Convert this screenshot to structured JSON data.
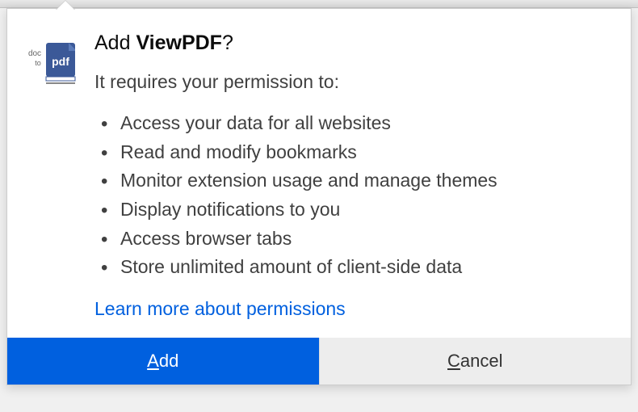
{
  "dialog": {
    "title_prefix": "Add ",
    "title_name": "ViewPDF",
    "title_suffix": "?",
    "subtitle": "It requires your permission to:",
    "permissions": [
      "Access your data for all websites",
      "Read and modify bookmarks",
      "Monitor extension usage and manage themes",
      "Display notifications to you",
      "Access browser tabs",
      "Store unlimited amount of client-side data"
    ],
    "learn_more": "Learn more about permissions",
    "buttons": {
      "add_pre": "A",
      "add_post": "dd",
      "cancel_pre": "C",
      "cancel_post": "ancel"
    }
  },
  "icon": {
    "doc_label": "doc",
    "to_label": "to",
    "pdf_label": "pdf"
  }
}
